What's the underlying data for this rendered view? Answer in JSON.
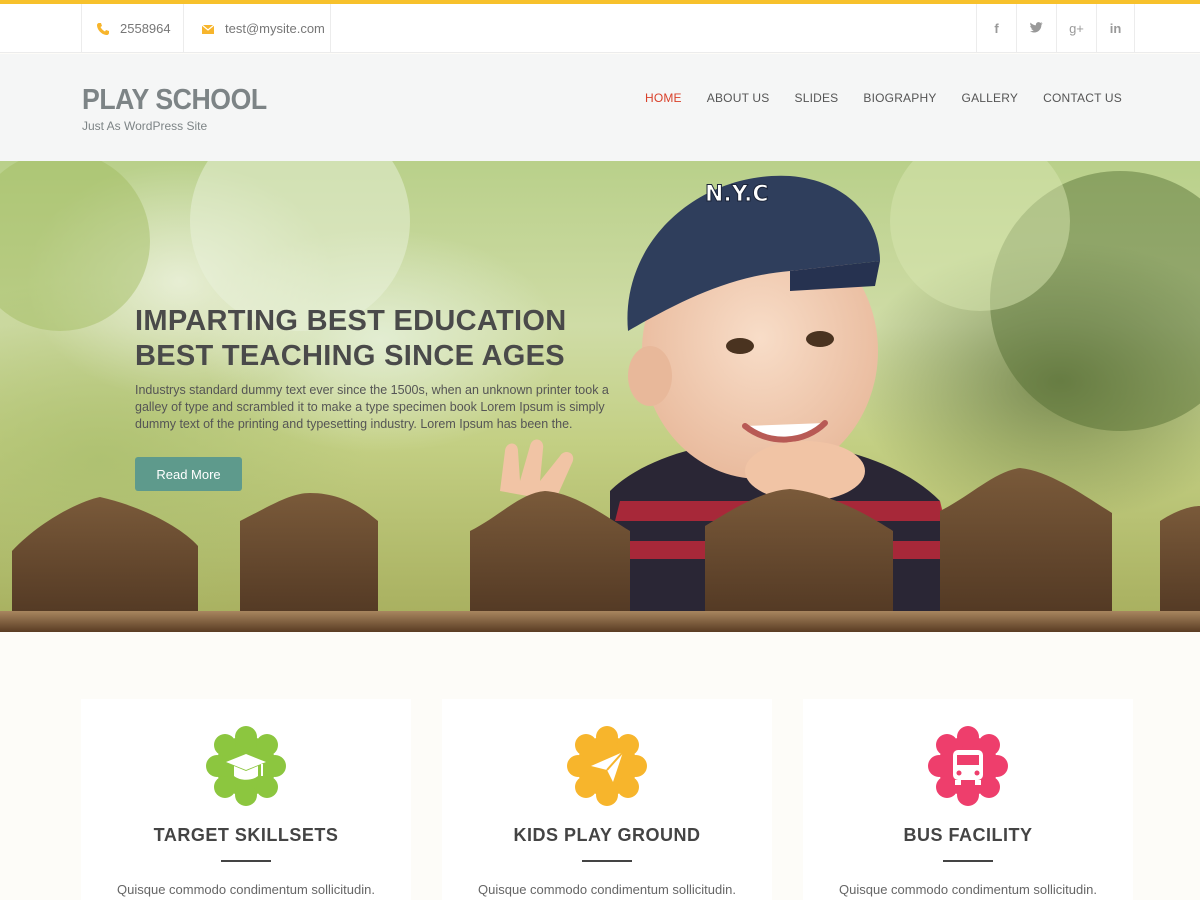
{
  "topbar": {
    "phone": "2558964",
    "email": "test@mysite.com",
    "social": [
      {
        "icon": "facebook-icon",
        "glyph": "f"
      },
      {
        "icon": "twitter-icon",
        "glyph": "t"
      },
      {
        "icon": "google-plus-icon",
        "glyph": "g+"
      },
      {
        "icon": "linkedin-icon",
        "glyph": "in"
      }
    ]
  },
  "header": {
    "title": "PLAY SCHOOL",
    "subtitle": "Just As WordPress Site",
    "nav": [
      "HOME",
      "ABOUT US",
      "SLIDES",
      "BIOGRAPHY",
      "GALLERY",
      "CONTACT US"
    ],
    "active_nav": "HOME"
  },
  "hero": {
    "title_line1": "IMPARTING BEST EDUCATION",
    "title_line2": "BEST TEACHING SINCE AGES",
    "text": "Industrys standard dummy text ever since the 1500s, when an unknown printer took a galley of type and scrambled it to make a type specimen book Lorem Ipsum is simply dummy text of the printing and typesetting industry. Lorem Ipsum has been the.",
    "button": "Read More",
    "cap_text": "N.Y.C"
  },
  "features": [
    {
      "title": "TARGET SKILLSETS",
      "text": "Quisque commodo condimentum sollicitudin.",
      "icon": "graduation-cap-icon",
      "color": "#8cc63f"
    },
    {
      "title": "KIDS PLAY GROUND",
      "text": "Quisque commodo condimentum sollicitudin.",
      "icon": "paper-plane-icon",
      "color": "#f7b52c"
    },
    {
      "title": "BUS FACILITY",
      "text": "Quisque commodo condimentum sollicitudin.",
      "icon": "bus-icon",
      "color": "#ee3e6c"
    }
  ],
  "colors": {
    "accent": "#f7c12b",
    "nav_active": "#d9412b",
    "button": "#5e9a8c"
  }
}
